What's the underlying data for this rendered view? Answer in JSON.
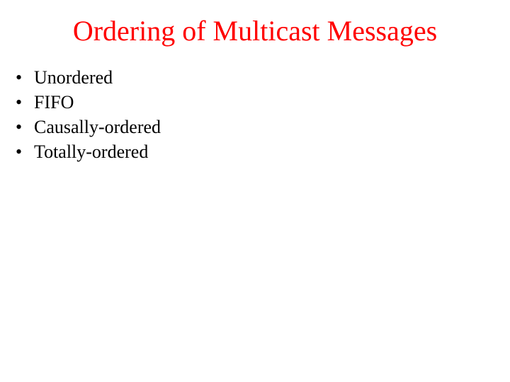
{
  "title": "Ordering of Multicast Messages",
  "bullets": [
    "Unordered",
    "FIFO",
    "Causally-ordered",
    "Totally-ordered"
  ]
}
